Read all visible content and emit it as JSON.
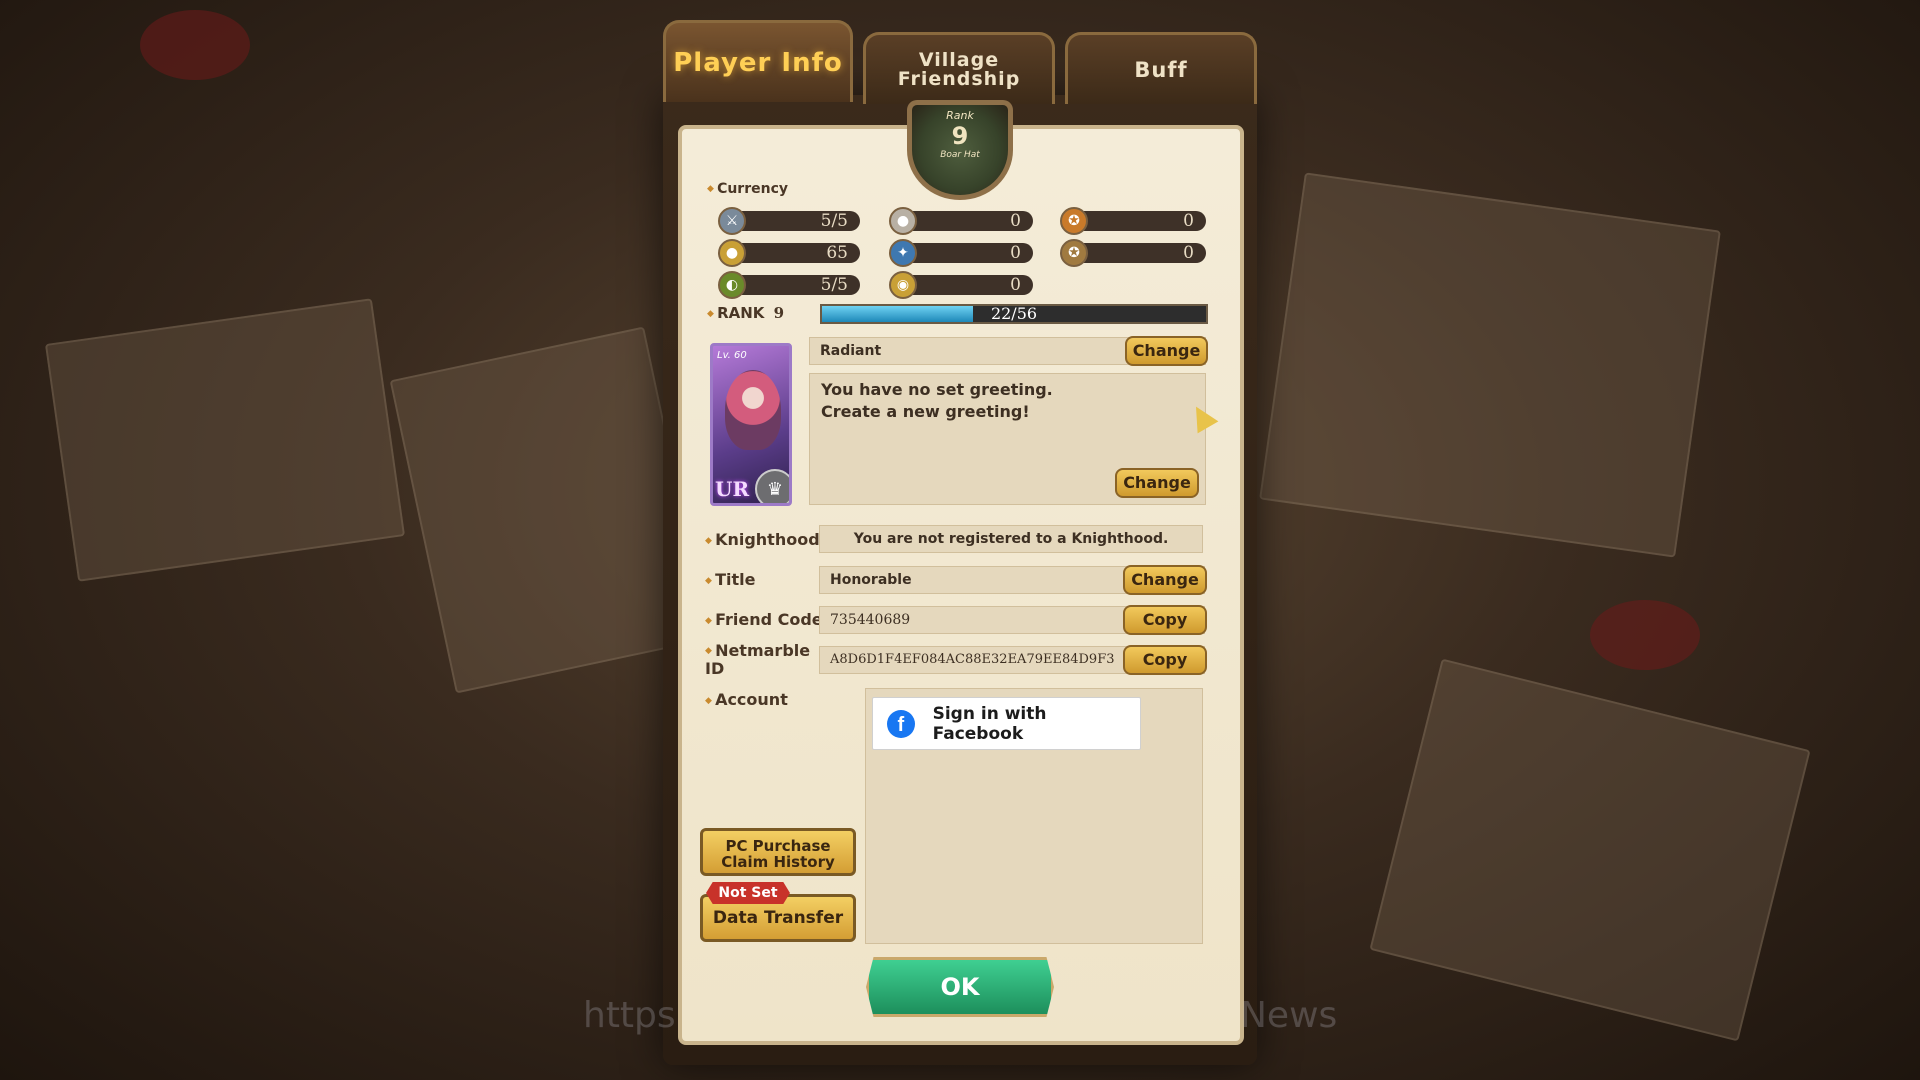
{
  "tabs": [
    {
      "label": "Player Info",
      "active": true
    },
    {
      "label": "Village Friendship",
      "active": false
    },
    {
      "label": "Buff",
      "active": false
    }
  ],
  "emblem": {
    "label": "Rank",
    "rank": "9",
    "sub": "Boar Hat"
  },
  "currency": {
    "label": "Currency",
    "items": [
      {
        "icon": "crossed-swords-icon",
        "value": "5/5",
        "color": "#7a8a9a"
      },
      {
        "icon": "silver-coin-icon",
        "value": "0",
        "color": "#b8b0a4"
      },
      {
        "icon": "gold-medal-icon",
        "value": "0",
        "color": "#c97a2a"
      },
      {
        "icon": "gold-coin-icon",
        "value": "65",
        "color": "#c9a036"
      },
      {
        "icon": "blue-gem-icon",
        "value": "0",
        "color": "#3f78b0"
      },
      {
        "icon": "bronze-medal-icon",
        "value": "0",
        "color": "#a07a40"
      },
      {
        "icon": "stamina-icon",
        "value": "5/5",
        "color": "#6a8a2a"
      },
      {
        "icon": "gold-token-icon",
        "value": "0",
        "color": "#c9a036"
      }
    ]
  },
  "rank": {
    "label": "RANK",
    "level": "9",
    "progress_text": "22/56",
    "progress": 0.393
  },
  "character_card": {
    "level": "Lv. 60",
    "grade": "UR"
  },
  "name_field": {
    "value": "Radiant",
    "button": "Change"
  },
  "greeting": {
    "line1": "You have no set greeting.",
    "line2": "Create a new greeting!",
    "button": "Change"
  },
  "knighthood": {
    "label": "Knighthood",
    "value": "You are not registered to a Knighthood."
  },
  "title": {
    "label": "Title",
    "value": "Honorable",
    "button": "Change"
  },
  "friend_code": {
    "label": "Friend Code",
    "value": "735440689",
    "button": "Copy"
  },
  "netmarble_id": {
    "label": "Netmarble ID",
    "value": "A8D6D1F4EF084AC88E32EA79EE84D9F3",
    "button": "Copy"
  },
  "account": {
    "label": "Account",
    "facebook_button": "Sign in with Facebook"
  },
  "pc_purchase": {
    "line1": "PC Purchase",
    "line2": "Claim History"
  },
  "data_transfer": {
    "badge": "Not Set",
    "label": "Data Transfer"
  },
  "ok_button": "OK",
  "watermark": {
    "left": "https",
    "right": "News"
  }
}
